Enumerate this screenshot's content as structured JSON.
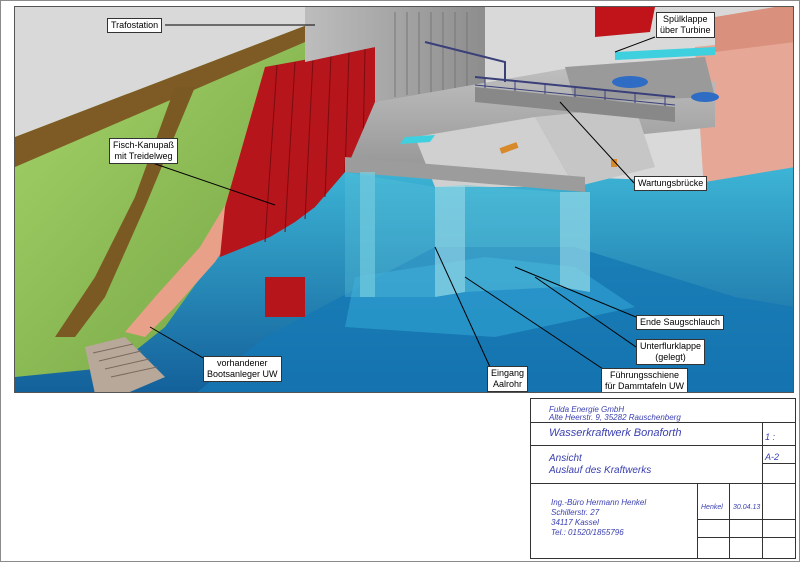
{
  "labels": {
    "trafostation": "Trafostation",
    "spuelklappe": [
      "Spülklappe",
      "über Turbine"
    ],
    "fischkanupass": [
      "Fisch-Kanupaß",
      "mit Treidelweg"
    ],
    "wartungsbruecke": "Wartungsbrücke",
    "ende_saugschlauch": "Ende Saugschlauch",
    "unterflurklappe": [
      "Unterflurklappe",
      "(gelegt)"
    ],
    "fuehrungsschiene": [
      "Führungsschiene",
      "für Dammtafeln UW"
    ],
    "eingang_aalrohr": [
      "Eingang",
      "Aalrohr"
    ],
    "bootsanleger": [
      "vorhandener",
      "Bootsanleger UW"
    ]
  },
  "titleblock": {
    "client_line1": "Fulda Energie GmbH",
    "client_line2": "Alte Heerstr. 9, 35282 Rauschenberg",
    "project": "Wasserkraftwerk Bonaforth",
    "scale_value": "1 :",
    "drawing_line1": "Ansicht",
    "drawing_line2": "Auslauf des Kraftwerks",
    "sheet_value": "A-2",
    "office_line1": "Ing.-Büro Hermann Henkel",
    "office_line2": "Schillerstr. 27",
    "office_line3": "34117 Kassel",
    "office_line4": "Tel.: 01520/1855796",
    "drawn_by": "Henkel",
    "date": "30.04.13"
  },
  "colors": {
    "water_dark": "#1a6fa8",
    "water_light": "#4ad0e0",
    "concrete": "#a8a8a8",
    "sheet_pile_red": "#b5151b",
    "embankment_green": "#8fc65a",
    "path_brown": "#7a5a22",
    "wall_salmon": "#e8a088",
    "title_text_blue": "#3a3fb0"
  }
}
